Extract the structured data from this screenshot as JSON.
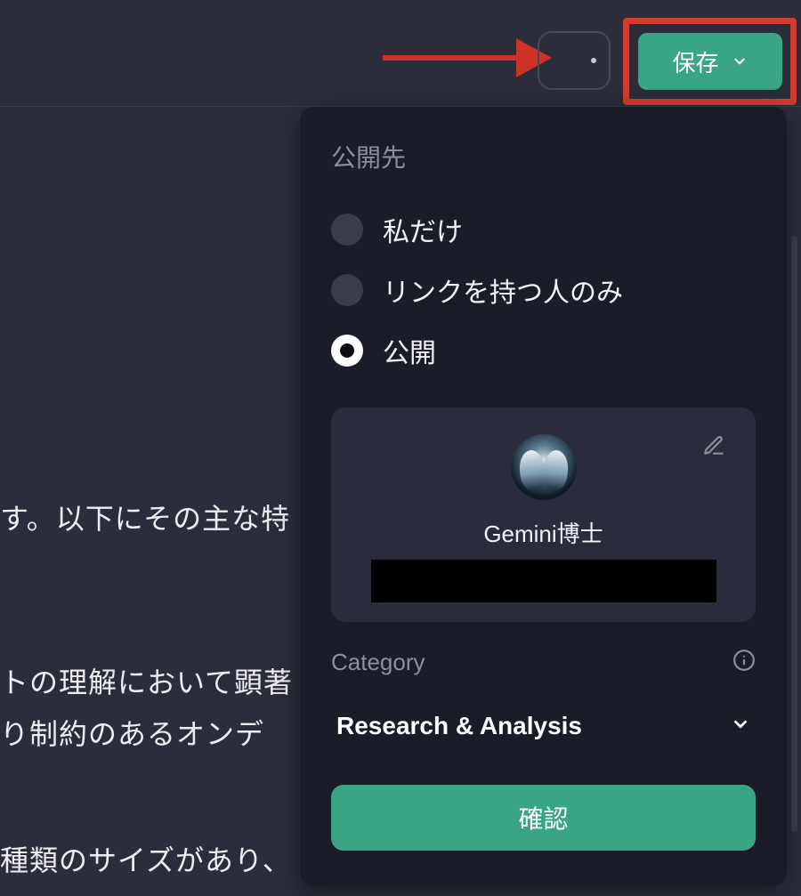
{
  "toolbar": {
    "save_label": "保存"
  },
  "dropdown": {
    "title": "公開先",
    "options": [
      {
        "label": "私だけ",
        "selected": false
      },
      {
        "label": "リンクを持つ人のみ",
        "selected": false
      },
      {
        "label": "公開",
        "selected": true
      }
    ],
    "profile": {
      "name": "Gemini博士"
    },
    "category_label": "Category",
    "category_value": "Research & Analysis",
    "confirm_label": "確認"
  },
  "background_text": {
    "line1": "す。以下にその主な特",
    "line2": "トの理解において顕著",
    "line3": "り制約のあるオンデ",
    "line4": "種類のサイズがあり、"
  }
}
